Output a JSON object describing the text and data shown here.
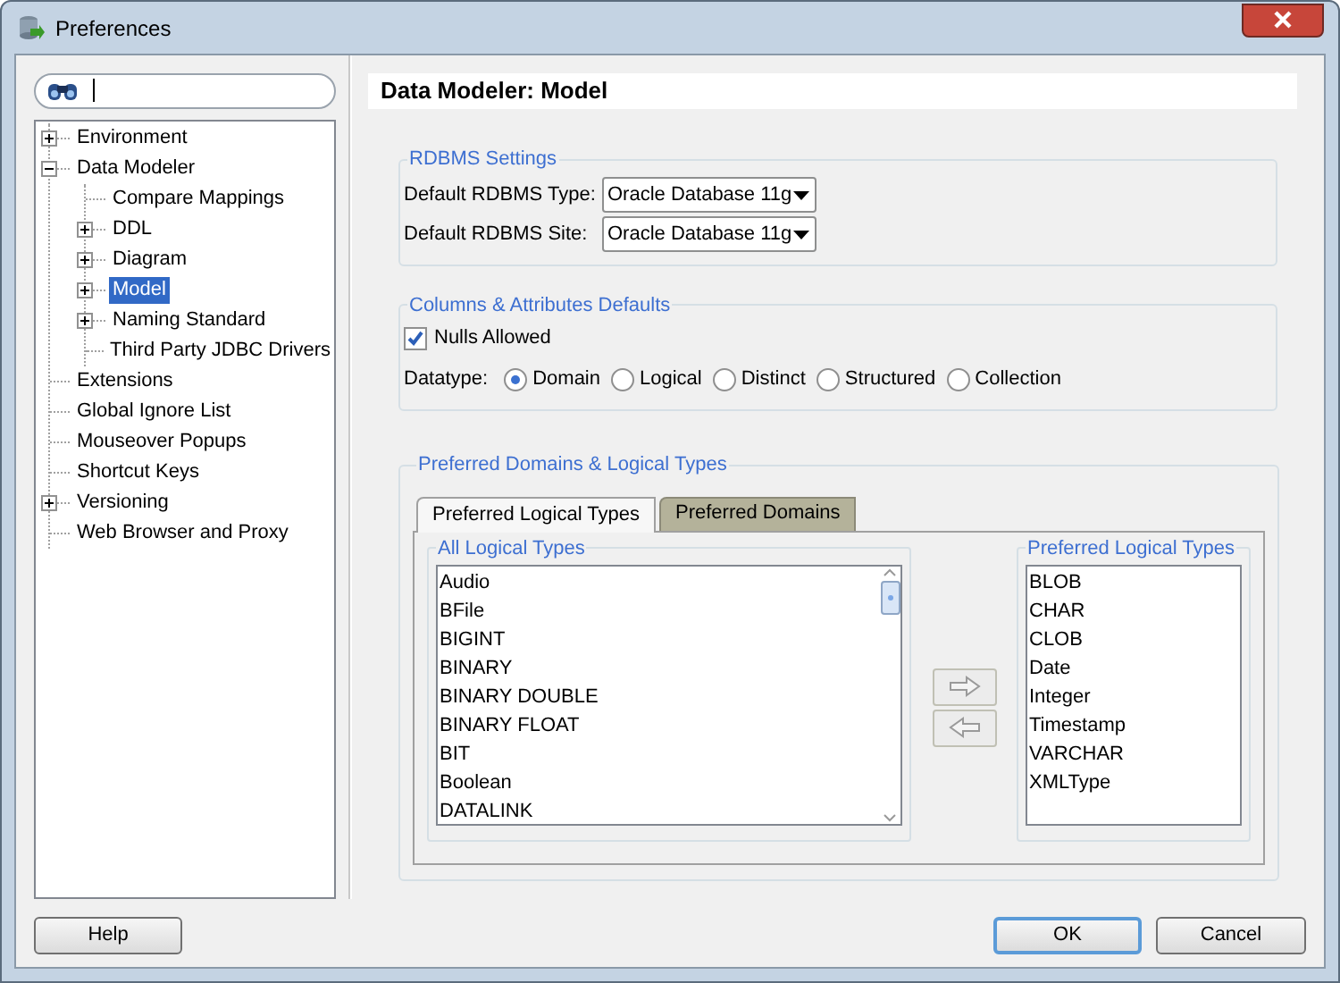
{
  "window": {
    "title": "Preferences"
  },
  "tree": [
    {
      "label": "Environment",
      "expanded": false,
      "selected": false
    },
    {
      "label": "Data Modeler",
      "expanded": true,
      "selected": false,
      "children": [
        {
          "label": "Compare Mappings",
          "selected": false
        },
        {
          "label": "DDL",
          "expanded": false,
          "selected": false
        },
        {
          "label": "Diagram",
          "expanded": false,
          "selected": false
        },
        {
          "label": "Model",
          "expanded": false,
          "selected": true
        },
        {
          "label": "Naming Standard",
          "expanded": false,
          "selected": false
        },
        {
          "label": "Third Party JDBC Drivers",
          "selected": false
        }
      ]
    },
    {
      "label": "Extensions",
      "selected": false
    },
    {
      "label": "Global Ignore List",
      "selected": false
    },
    {
      "label": "Mouseover Popups",
      "selected": false
    },
    {
      "label": "Shortcut Keys",
      "selected": false
    },
    {
      "label": "Versioning",
      "expanded": false,
      "selected": false
    },
    {
      "label": "Web Browser and Proxy",
      "selected": false
    }
  ],
  "header": "Data Modeler: Model",
  "rdbms": {
    "legend": "RDBMS Settings",
    "fields": [
      {
        "label": "Default RDBMS Type:",
        "value": "Oracle Database 11g"
      },
      {
        "label": "Default RDBMS Site:",
        "value": "Oracle Database 11g"
      }
    ]
  },
  "columns_defaults": {
    "legend": "Columns & Attributes Defaults",
    "nulls_allowed": {
      "label": "Nulls Allowed",
      "checked": true
    },
    "datatype": {
      "label": "Datatype:",
      "options": [
        {
          "label": "Domain",
          "selected": true
        },
        {
          "label": "Logical",
          "selected": false
        },
        {
          "label": "Distinct",
          "selected": false
        },
        {
          "label": "Structured",
          "selected": false
        },
        {
          "label": "Collection",
          "selected": false
        }
      ]
    }
  },
  "preferred": {
    "legend": "Preferred Domains & Logical Types",
    "tabs": [
      {
        "label": "Preferred Logical Types",
        "selected": true
      },
      {
        "label": "Preferred Domains",
        "selected": false
      }
    ],
    "all_types": {
      "legend": "All Logical Types",
      "items": [
        "Audio",
        "BFile",
        "BIGINT",
        "BINARY",
        "BINARY DOUBLE",
        "BINARY FLOAT",
        "BIT",
        "Boolean",
        "DATALINK"
      ]
    },
    "preferred_types": {
      "legend": "Preferred Logical Types",
      "items": [
        "BLOB",
        "CHAR",
        "CLOB",
        "Date",
        "Integer",
        "Timestamp",
        "VARCHAR",
        "XMLType"
      ]
    }
  },
  "buttons": [
    {
      "label": "Help",
      "default": false
    },
    {
      "label": "OK",
      "default": true
    },
    {
      "label": "Cancel",
      "default": false
    }
  ]
}
